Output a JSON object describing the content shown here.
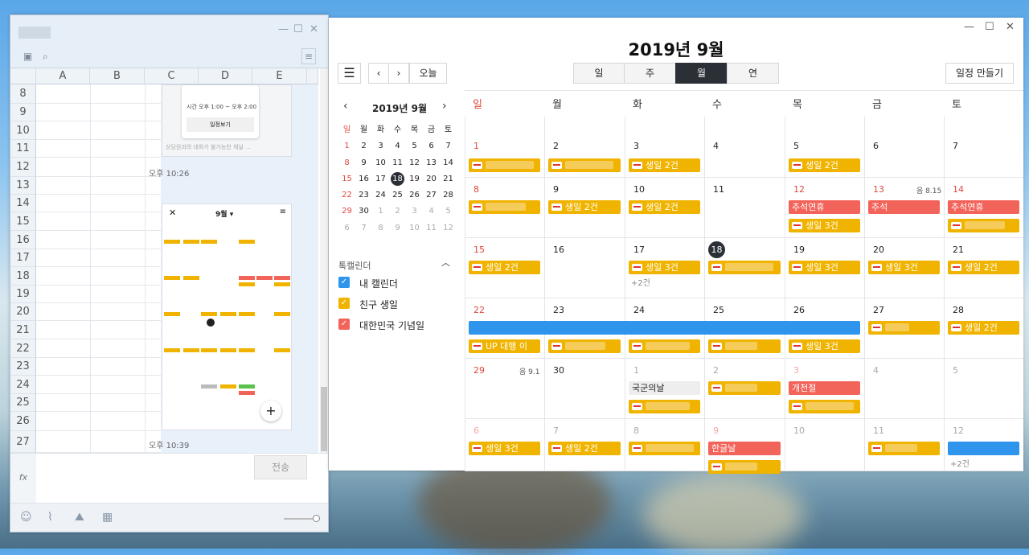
{
  "left_window": {
    "columns": [
      "A",
      "B",
      "C",
      "D",
      "E"
    ],
    "rows": [
      "8",
      "9",
      "10",
      "11",
      "12",
      "13",
      "14",
      "15",
      "16",
      "17",
      "18",
      "19",
      "20",
      "21",
      "22",
      "23",
      "24",
      "25",
      "26",
      "27"
    ],
    "bubble1": {
      "time": "시간",
      "time_value": "오후 1:00 ~ 오후 2:00",
      "button": "일정보기",
      "placeholder": "상담원과의 대화가 불가능한 채널 ..."
    },
    "timestamp1": "오후 10:26",
    "timestamp2": "오후 10:39",
    "mini_cal_title": "9월",
    "mini_cal_title_arrow": "▾",
    "fx": "fx",
    "send": "전송"
  },
  "calendar": {
    "title": "2019년 9월",
    "today_btn": "오늘",
    "views": [
      "일",
      "주",
      "월",
      "연"
    ],
    "create_btn": "일정 만들기",
    "mini": {
      "title": "2019년 9월",
      "weekdays": [
        "일",
        "월",
        "화",
        "수",
        "목",
        "금",
        "토"
      ]
    },
    "category_header": "톡캘린더",
    "categories": [
      {
        "label": "내 캘린더",
        "color": "#2f95ec"
      },
      {
        "label": "친구 생일",
        "color": "#f0b400"
      },
      {
        "label": "대한민국 기념일",
        "color": "#f2635a"
      }
    ],
    "weekdays": [
      "일",
      "월",
      "화",
      "수",
      "목",
      "금",
      "토"
    ],
    "lunar_13": "음 8.15",
    "lunar_29": "음 9.1",
    "events": {
      "e3": "생일 2건",
      "e5": "생일 2건",
      "e9": "생일 2건",
      "e10": "생일 2건",
      "e12a": "추석연휴",
      "e12b": "생일 3건",
      "e13": "추석",
      "e14": "추석연휴",
      "e15": "생일 2건",
      "e17": "생일 3건",
      "e17more": "+2건",
      "e19": "생일 3건",
      "e20": "생일 3건",
      "e21": "생일 2건",
      "e22partial": "UP 대행 이",
      "e26": "생일 3건",
      "e28": "생일 2건",
      "e1oct": "국군의날",
      "e3oct": "개천절",
      "e6oct": "생일 3건",
      "e7oct": "생일 2건",
      "e9oct": "한글날",
      "e12more": "+2건"
    },
    "colors": {
      "birthday": "#f0b400",
      "holiday": "#f2635a",
      "mine": "#2f95ec",
      "today": "#2b2f36"
    }
  }
}
